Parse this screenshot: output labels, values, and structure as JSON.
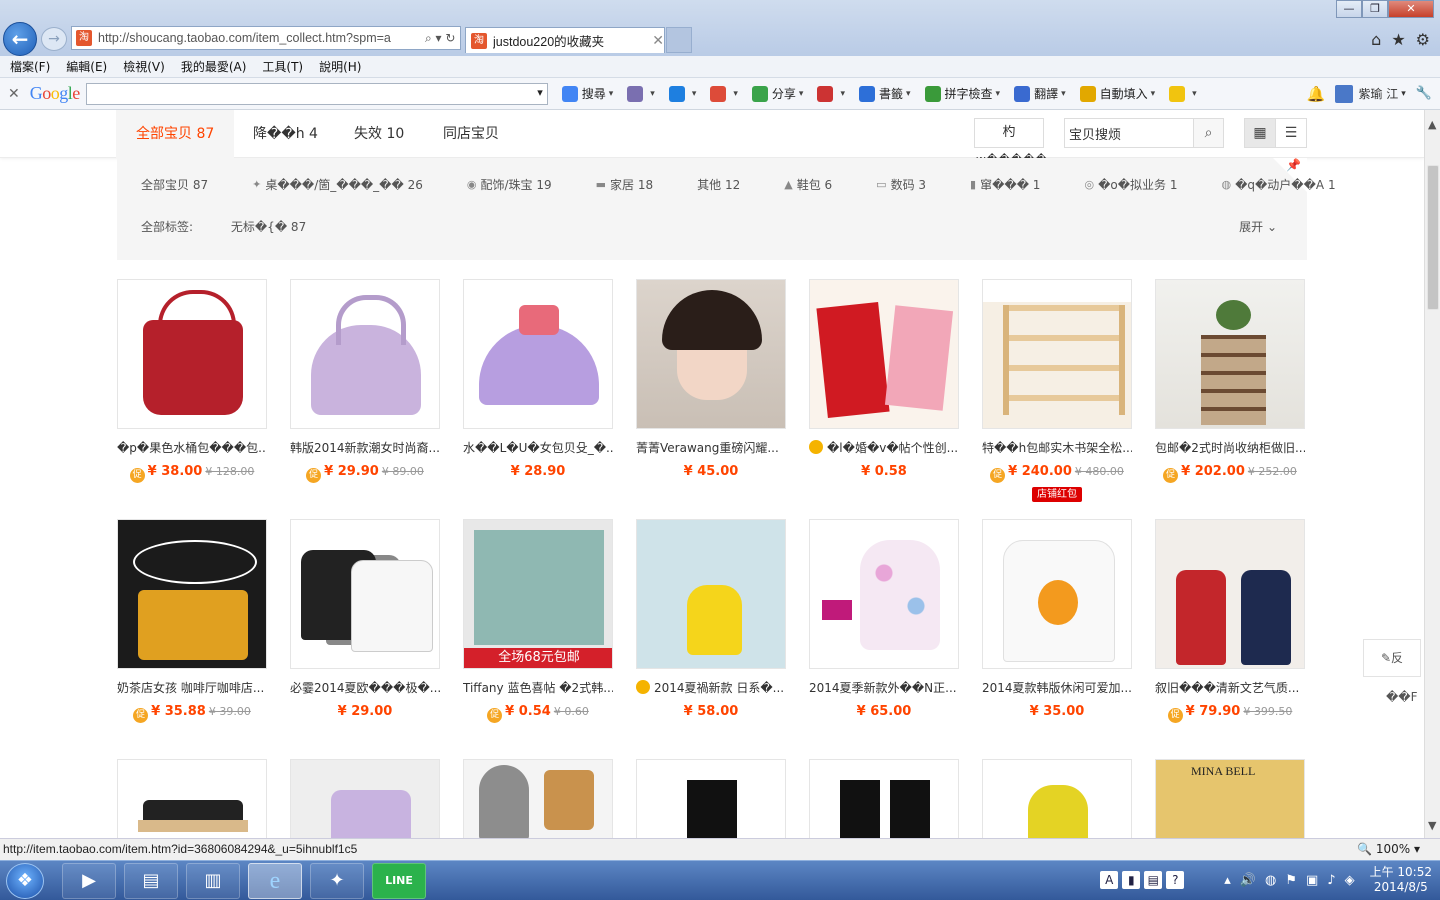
{
  "browser": {
    "address_url": "http://shoucang.taobao.com/item_collect.htm?spm=a",
    "address_icons": "⌕ ▾ ↻",
    "tab_title": "justdou220的收藏夹",
    "window_buttons": {
      "minimize": "—",
      "maximize": "❐",
      "close": "✕"
    },
    "command_icons": {
      "home": "⌂",
      "favorites": "★",
      "tools": "⚙"
    },
    "menu": [
      "檔案(F)",
      "編輯(E)",
      "檢視(V)",
      "我的最愛(A)",
      "工具(T)",
      "說明(H)"
    ],
    "google_toolbar": {
      "logo": "Google",
      "close": "✕",
      "tools": [
        {
          "label": "搜尋",
          "color": "#4285f4"
        },
        {
          "label": "",
          "color": "#7a6fb0"
        },
        {
          "label": "",
          "color": "#1e7fe0"
        },
        {
          "label": "",
          "color": "#dd4b39"
        },
        {
          "label": "分享",
          "color": "#3aa34a"
        },
        {
          "label": "",
          "color": "#c33"
        },
        {
          "label": "書籤",
          "color": "#2d6fd8"
        },
        {
          "label": "拼字檢查",
          "color": "#3a9a3a"
        },
        {
          "label": "翻譯",
          "color": "#3a6ad0"
        },
        {
          "label": "自動填入",
          "color": "#e2a800"
        },
        {
          "label": "",
          "color": "#f1c40f"
        }
      ],
      "user_name": "紫瑜 江"
    },
    "status_url": "http://item.taobao.com/item.htm?id=36806084294&_u=5ihnublf1c5",
    "zoom": "100%"
  },
  "page": {
    "tabs": [
      {
        "label": "全部宝贝 87",
        "active": true
      },
      {
        "label": "降��h 4",
        "active": false
      },
      {
        "label": "失效 10",
        "active": false
      },
      {
        "label": "同店宝贝",
        "active": false
      }
    ],
    "category_button": "杓",
    "category_button_sub": "w�����",
    "search_placeholder": "宝贝搜烦",
    "search_icon": "⌕",
    "view_grid_icon": "▦",
    "view_list_icon": "☰",
    "filter_categories": [
      {
        "icon": "",
        "label": "全部宝贝 87"
      },
      {
        "icon": "✦",
        "label": "桌���/箇_���_�� 26"
      },
      {
        "icon": "◉",
        "label": "配饰/珠宝 19"
      },
      {
        "icon": "▬",
        "label": "家居 18"
      },
      {
        "icon": "",
        "label": "其他 12"
      },
      {
        "icon": "▲",
        "label": "鞋包 6"
      },
      {
        "icon": "▭",
        "label": "数码 3"
      },
      {
        "icon": "▮",
        "label": "窜��� 1"
      },
      {
        "icon": "◎",
        "label": "�o�拟业务 1"
      },
      {
        "icon": "◍",
        "label": "�q�动户��A 1"
      }
    ],
    "tags_label": "全部标签:",
    "tags_value": "无标�{� 87",
    "expand_label": "展开 ⌄",
    "feedback_label": "✎反",
    "feedback_sub": "��F"
  },
  "products": [
    {
      "image": "bag-red",
      "title": "�p�果色水桶包���包...",
      "promo": true,
      "price": "¥ 38.00",
      "orig": "¥ 128.00"
    },
    {
      "image": "bag-purple",
      "title": "韩版2014新款潮女时尚裔...",
      "promo": true,
      "price": "¥ 29.90",
      "orig": "¥ 89.00"
    },
    {
      "image": "bag-lav",
      "title": "水��L�U�女包贝殳_�...",
      "promo": false,
      "price": "¥ 28.90",
      "orig": ""
    },
    {
      "image": "portrait",
      "title": "菁菁Verawang重磅闪耀...",
      "promo": false,
      "price": "¥ 45.00",
      "orig": ""
    },
    {
      "image": "invite",
      "title": "�l�婚�v�帖个性创...",
      "gold": true,
      "promo": false,
      "price": "¥ 0.58",
      "orig": ""
    },
    {
      "image": "shelf",
      "title": "特��h包邮实木书架全松...",
      "promo": true,
      "price": "¥ 240.00",
      "orig": "¥ 480.00",
      "badge": "店铺红包"
    },
    {
      "image": "cabinet",
      "title": "包邮�2式时尚收纳柜做旧...",
      "promo": true,
      "price": "¥ 202.00",
      "orig": "¥ 252.00"
    },
    {
      "image": "cafe",
      "title": "奶茶店女孩 咖啡厅咖啡店...",
      "promo": true,
      "price": "¥ 35.88",
      "orig": "¥ 39.00"
    },
    {
      "image": "tees",
      "title": "必霎2014夏欧���极�...",
      "promo": false,
      "price": "¥ 29.00",
      "orig": ""
    },
    {
      "image": "bookcover",
      "title": "Tiffany 蓝色喜帖 �2式韩...",
      "promo": true,
      "price": "¥ 0.54",
      "orig": "¥ 0.60"
    },
    {
      "image": "yellowdress",
      "title": "2014夏禍新款 日系�...",
      "gold": true,
      "promo": false,
      "price": "¥ 58.00",
      "orig": ""
    },
    {
      "image": "floral",
      "title": "2014夏季新款外��N正...",
      "promo": false,
      "price": "¥ 65.00",
      "orig": ""
    },
    {
      "image": "garfield",
      "title": "2014夏款韩版休闲可爱加...",
      "promo": false,
      "price": "¥ 35.00",
      "orig": ""
    },
    {
      "image": "reddress",
      "title": "叙旧���清新文艺气质...",
      "promo": true,
      "price": "¥ 79.90",
      "orig": "¥ 399.50"
    },
    {
      "image": "sandals",
      "title": "",
      "promo": false,
      "price": "",
      "orig": ""
    },
    {
      "image": "lavtop",
      "title": "",
      "promo": false,
      "price": "",
      "orig": ""
    },
    {
      "image": "wedges",
      "title": "",
      "promo": false,
      "price": "",
      "orig": ""
    },
    {
      "image": "skirt1",
      "title": "",
      "promo": false,
      "price": "",
      "orig": ""
    },
    {
      "image": "skirt2",
      "title": "",
      "promo": false,
      "price": "",
      "orig": ""
    },
    {
      "image": "backpack",
      "title": "",
      "promo": false,
      "price": "",
      "orig": ""
    },
    {
      "image": "gold",
      "title": "",
      "promo": false,
      "price": "",
      "orig": ""
    }
  ],
  "taskbar": {
    "start_icon": "❖",
    "apps": [
      {
        "name": "media-player",
        "icon": "▶",
        "active": false
      },
      {
        "name": "file-explorer",
        "icon": "▤",
        "active": false
      },
      {
        "name": "folder",
        "icon": "▥",
        "active": false
      },
      {
        "name": "internet-explorer",
        "icon": "e",
        "active": true
      },
      {
        "name": "network-app",
        "icon": "✦",
        "active": false
      },
      {
        "name": "line",
        "icon": "LINE",
        "active": false
      }
    ],
    "ime": [
      "A",
      "▮",
      "▤",
      "?"
    ],
    "tray_icons": [
      "▴",
      "🔊",
      "◍",
      "⚑",
      "▣",
      "♪",
      "◈"
    ],
    "time": "上午 10:52",
    "date": "2014/8/5"
  }
}
